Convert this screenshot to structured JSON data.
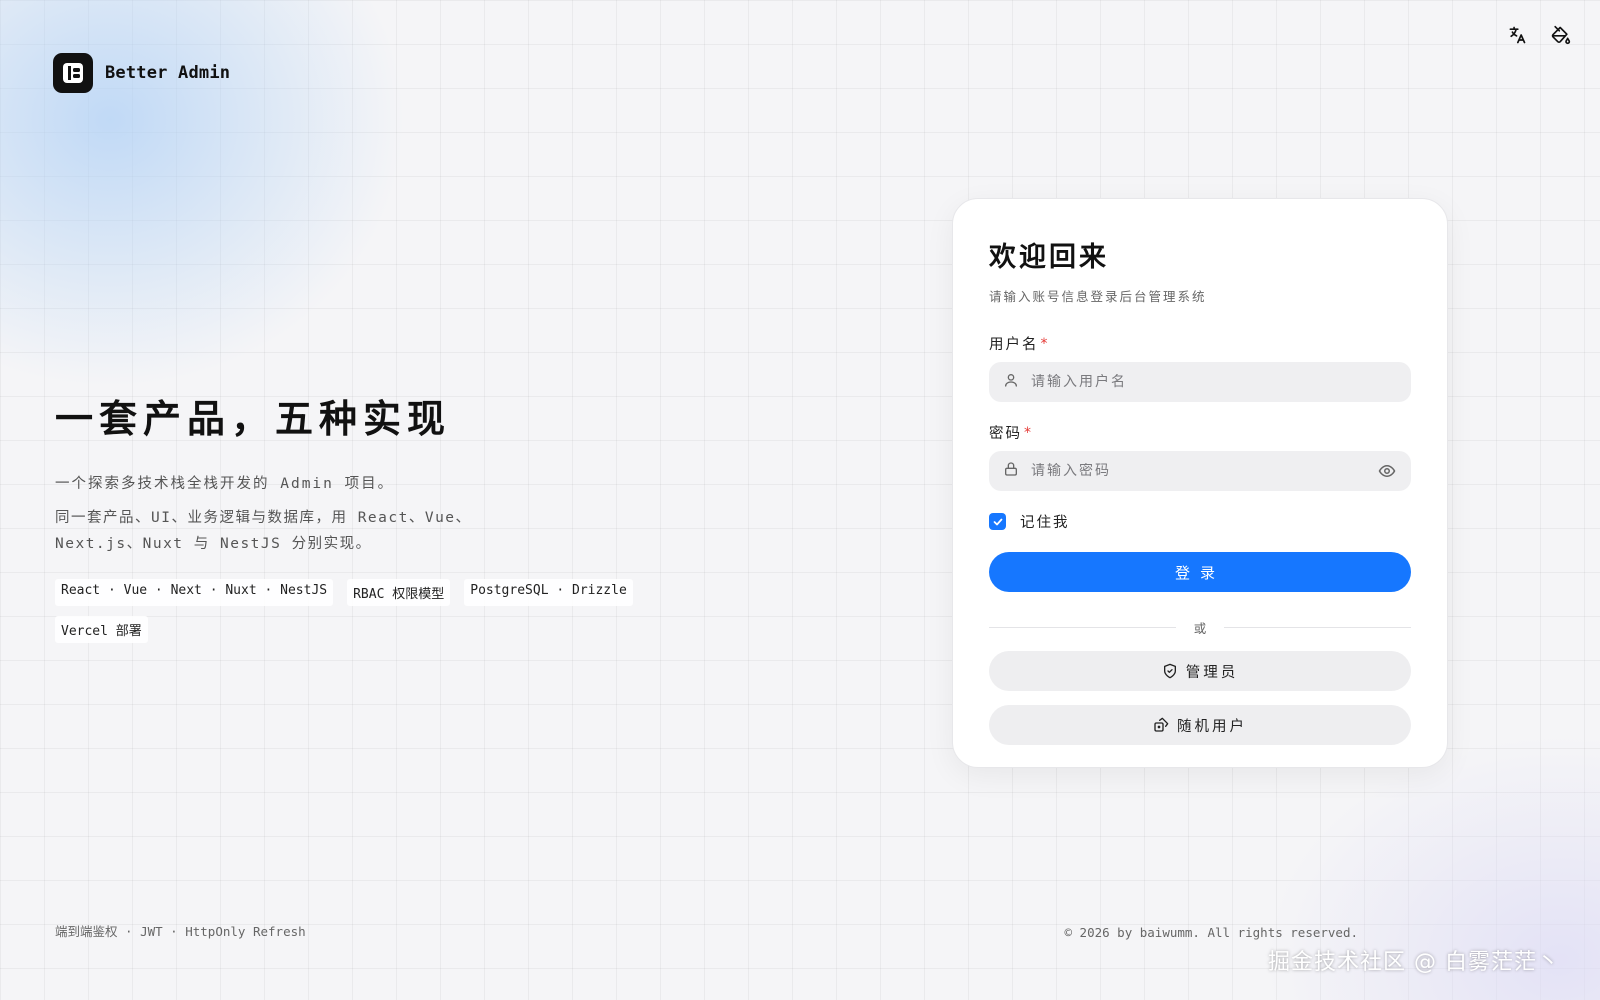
{
  "brand": {
    "name": "Better Admin",
    "logo_icon": "logo-icon"
  },
  "top_icons": [
    "translate-icon",
    "paint-bucket-icon"
  ],
  "hero": {
    "title": "一套产品，五种实现",
    "subtitle": "一个探索多技术栈全栈开发的 Admin 项目。",
    "description": "同一套产品、UI、业务逻辑与数据库，用 React、Vue、Next.js、Nuxt 与 NestJS 分别实现。",
    "tags": [
      "React · Vue · Next · Nuxt · NestJS",
      "RBAC 权限模型",
      "PostgreSQL · Drizzle",
      "Vercel 部署"
    ]
  },
  "login": {
    "title": "欢迎回来",
    "subtitle": "请输入账号信息登录后台管理系统",
    "username_label": "用户名",
    "username_placeholder": "请输入用户名",
    "password_label": "密码",
    "password_placeholder": "请输入密码",
    "required_mark": "*",
    "remember_label": "记住我",
    "remember_checked": true,
    "login_button": "登录",
    "divider_text": "或",
    "admin_button": "管理员",
    "random_user_button": "随机用户"
  },
  "footer": {
    "left": "端到端鉴权 · JWT · HttpOnly Refresh",
    "right": "© 2026 by baiwumm. All rights reserved."
  },
  "watermark": "掘金技术社区 @ 白雾茫茫丶",
  "colors": {
    "accent": "#1677ff",
    "required": "#e53935",
    "brand_dark": "#111111"
  }
}
